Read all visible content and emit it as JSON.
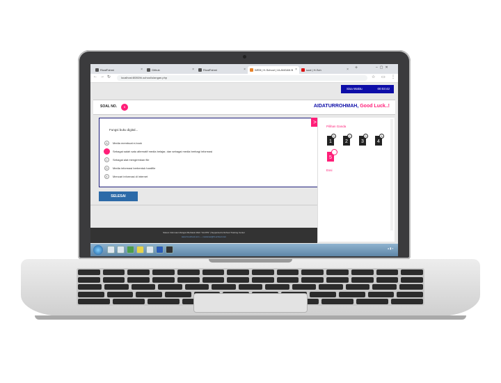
{
  "browser": {
    "tabs": [
      {
        "label": "RizalFahmi",
        "active": false
      },
      {
        "label": "Github",
        "active": false
      },
      {
        "label": "RizalFahmi",
        "active": false
      },
      {
        "label": "WEB | H-School | ULANGAN B",
        "active": true
      },
      {
        "label": "soal | H-Sch",
        "active": false
      }
    ],
    "url": "localhost:8080/hi-school/ulangan.php"
  },
  "timer": {
    "label": "Sisa Waktu",
    "value": "00:03:42"
  },
  "question_header": {
    "label": "SOAL NO.",
    "number": "5",
    "greeting_name": "AIDATURROHMAH,",
    "greeting_text": "Good Luck..!"
  },
  "question": {
    "text": "Fungsi buku digital...",
    "options": [
      {
        "letter": "A",
        "text": "Media membuat e-book"
      },
      {
        "letter": "B",
        "text": "Sebagai salah satu alternatif media belajar, dan sebagai media berbagi informasi"
      },
      {
        "letter": "C",
        "text": "Sebagai alat mengirimkan file"
      },
      {
        "letter": "D",
        "text": "Media informasi berbentuk hardfile"
      },
      {
        "letter": "E",
        "text": "Mencari informasi di internet"
      }
    ],
    "next_label": ">"
  },
  "finish_button": "SELESAI",
  "side_panel": {
    "section1": "Pilihan Ganda",
    "numbers": [
      {
        "n": "1",
        "answer": "D"
      },
      {
        "n": "2",
        "answer": "C"
      },
      {
        "n": "3",
        "answer": "D"
      },
      {
        "n": "4",
        "answer": "A"
      },
      {
        "n": "5",
        "answer": ""
      }
    ],
    "section2": "Essi"
  },
  "footer": {
    "line1": "Sistem Informasi Ulangan Berbasis Web \"ULATIS\" | Supported H-School Training Center",
    "line2": "www.hi-school.com — customer@hi-school.com"
  },
  "colors": {
    "accent": "#ff1e78",
    "navy": "#0d0da8"
  }
}
